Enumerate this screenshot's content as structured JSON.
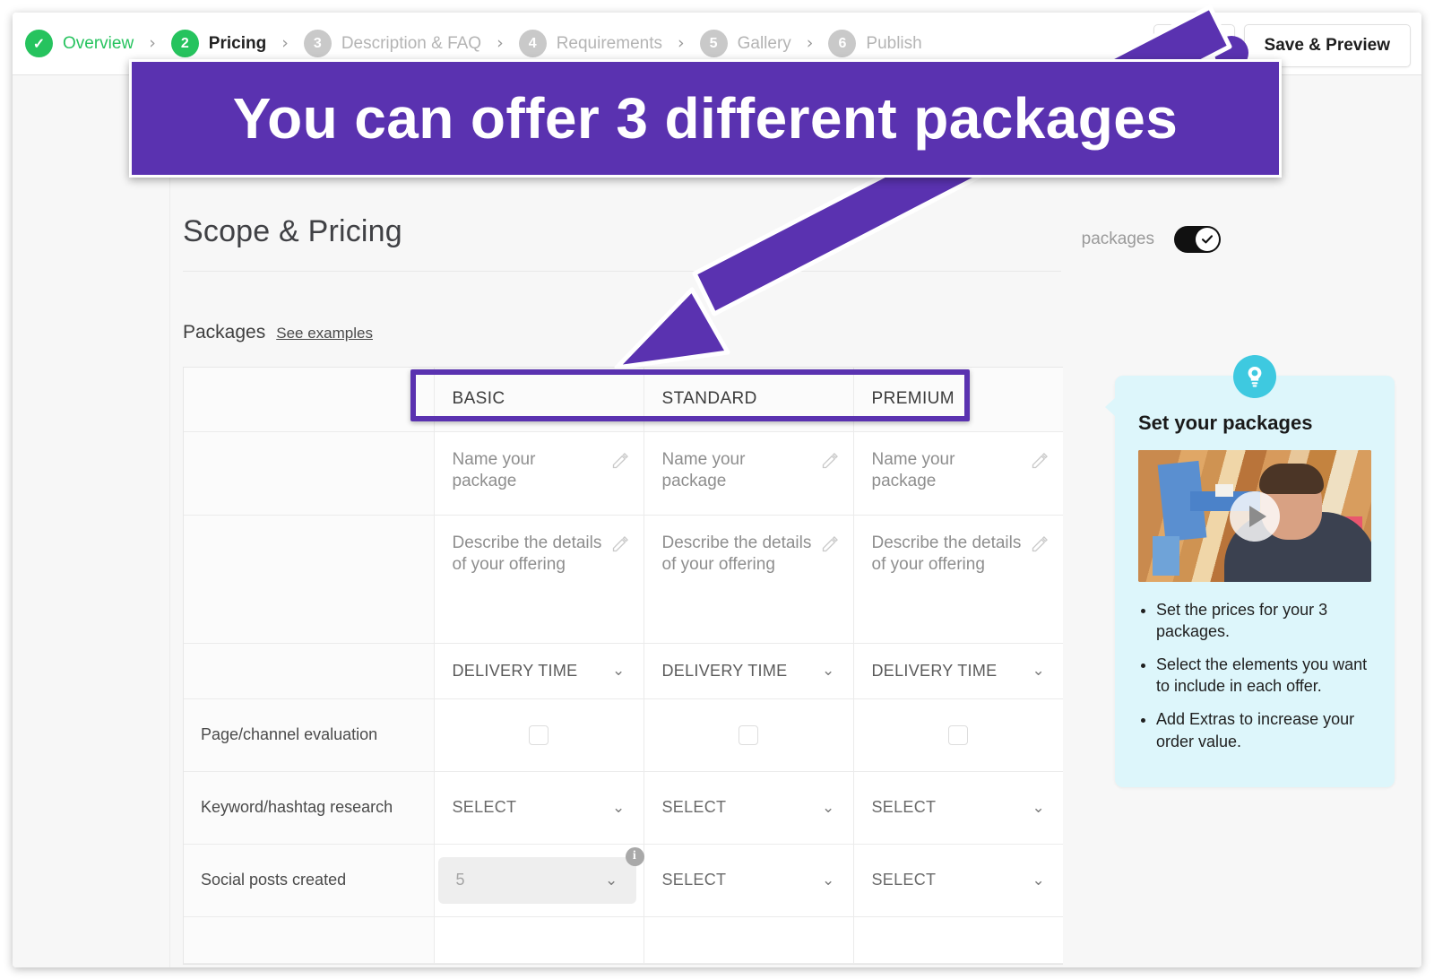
{
  "header": {
    "steps": [
      {
        "badge": "✓",
        "label": "Overview",
        "state": "done"
      },
      {
        "badge": "2",
        "label": "Pricing",
        "state": "current"
      },
      {
        "badge": "3",
        "label": "Description & FAQ",
        "state": "todo"
      },
      {
        "badge": "4",
        "label": "Requirements",
        "state": "todo"
      },
      {
        "badge": "5",
        "label": "Gallery",
        "state": "todo"
      },
      {
        "badge": "6",
        "label": "Publish",
        "state": "todo"
      }
    ],
    "save_label": "Save",
    "save_preview_label": "Save & Preview"
  },
  "annotation": {
    "banner_text": "You can offer 3 different packages",
    "accent_color": "#5a32b0"
  },
  "section": {
    "title": "Scope & Pricing",
    "toggle_label": "packages",
    "toggle_state": "on",
    "packages_label": "Packages",
    "see_examples_label": "See examples"
  },
  "table": {
    "columns": [
      "BASIC",
      "STANDARD",
      "PREMIUM"
    ],
    "name_placeholder": "Name your package",
    "desc_placeholder": "Describe the details of your offering",
    "delivery_label": "DELIVERY TIME",
    "select_label": "SELECT",
    "rows": [
      {
        "label": "Page/channel evaluation",
        "type": "checkbox",
        "values": [
          "",
          "",
          ""
        ]
      },
      {
        "label": "Keyword/hashtag research",
        "type": "select",
        "values": [
          "SELECT",
          "SELECT",
          "SELECT"
        ]
      },
      {
        "label": "Social posts created",
        "type": "select",
        "values": [
          "5",
          "SELECT",
          "SELECT"
        ],
        "filled_first": true,
        "info_badge": "i"
      }
    ]
  },
  "tip": {
    "icon": "lightbulb-icon",
    "title": "Set your packages",
    "video_label": "play-button",
    "bullets": [
      "Set the prices for your 3 packages.",
      "Select the elements you want to include in each offer.",
      "Add Extras to increase your order value."
    ],
    "card_color": "#ddf6fb",
    "icon_color": "#3ec9e0"
  }
}
